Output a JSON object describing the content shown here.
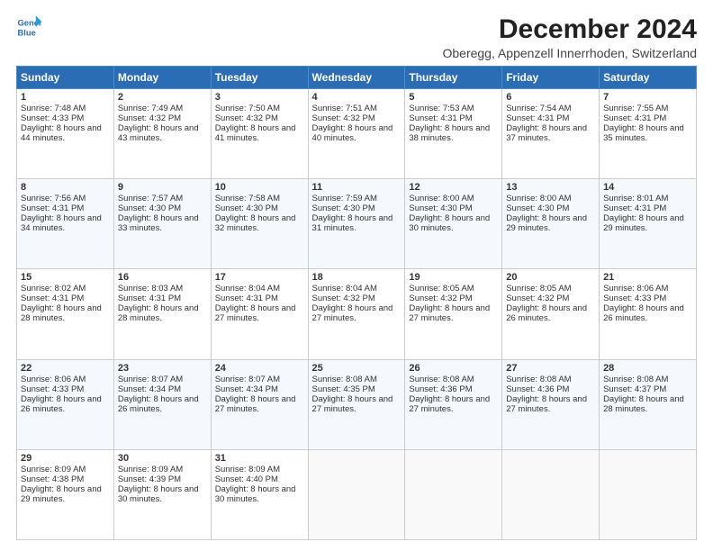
{
  "header": {
    "logo_line1": "General",
    "logo_line2": "Blue",
    "title": "December 2024",
    "subtitle": "Oberegg, Appenzell Innerrhoden, Switzerland"
  },
  "weekdays": [
    "Sunday",
    "Monday",
    "Tuesday",
    "Wednesday",
    "Thursday",
    "Friday",
    "Saturday"
  ],
  "weeks": [
    [
      {
        "day": "1",
        "rise": "Sunrise: 7:48 AM",
        "set": "Sunset: 4:33 PM",
        "daylight": "Daylight: 8 hours and 44 minutes."
      },
      {
        "day": "2",
        "rise": "Sunrise: 7:49 AM",
        "set": "Sunset: 4:32 PM",
        "daylight": "Daylight: 8 hours and 43 minutes."
      },
      {
        "day": "3",
        "rise": "Sunrise: 7:50 AM",
        "set": "Sunset: 4:32 PM",
        "daylight": "Daylight: 8 hours and 41 minutes."
      },
      {
        "day": "4",
        "rise": "Sunrise: 7:51 AM",
        "set": "Sunset: 4:32 PM",
        "daylight": "Daylight: 8 hours and 40 minutes."
      },
      {
        "day": "5",
        "rise": "Sunrise: 7:53 AM",
        "set": "Sunset: 4:31 PM",
        "daylight": "Daylight: 8 hours and 38 minutes."
      },
      {
        "day": "6",
        "rise": "Sunrise: 7:54 AM",
        "set": "Sunset: 4:31 PM",
        "daylight": "Daylight: 8 hours and 37 minutes."
      },
      {
        "day": "7",
        "rise": "Sunrise: 7:55 AM",
        "set": "Sunset: 4:31 PM",
        "daylight": "Daylight: 8 hours and 35 minutes."
      }
    ],
    [
      {
        "day": "8",
        "rise": "Sunrise: 7:56 AM",
        "set": "Sunset: 4:31 PM",
        "daylight": "Daylight: 8 hours and 34 minutes."
      },
      {
        "day": "9",
        "rise": "Sunrise: 7:57 AM",
        "set": "Sunset: 4:30 PM",
        "daylight": "Daylight: 8 hours and 33 minutes."
      },
      {
        "day": "10",
        "rise": "Sunrise: 7:58 AM",
        "set": "Sunset: 4:30 PM",
        "daylight": "Daylight: 8 hours and 32 minutes."
      },
      {
        "day": "11",
        "rise": "Sunrise: 7:59 AM",
        "set": "Sunset: 4:30 PM",
        "daylight": "Daylight: 8 hours and 31 minutes."
      },
      {
        "day": "12",
        "rise": "Sunrise: 8:00 AM",
        "set": "Sunset: 4:30 PM",
        "daylight": "Daylight: 8 hours and 30 minutes."
      },
      {
        "day": "13",
        "rise": "Sunrise: 8:00 AM",
        "set": "Sunset: 4:30 PM",
        "daylight": "Daylight: 8 hours and 29 minutes."
      },
      {
        "day": "14",
        "rise": "Sunrise: 8:01 AM",
        "set": "Sunset: 4:31 PM",
        "daylight": "Daylight: 8 hours and 29 minutes."
      }
    ],
    [
      {
        "day": "15",
        "rise": "Sunrise: 8:02 AM",
        "set": "Sunset: 4:31 PM",
        "daylight": "Daylight: 8 hours and 28 minutes."
      },
      {
        "day": "16",
        "rise": "Sunrise: 8:03 AM",
        "set": "Sunset: 4:31 PM",
        "daylight": "Daylight: 8 hours and 28 minutes."
      },
      {
        "day": "17",
        "rise": "Sunrise: 8:04 AM",
        "set": "Sunset: 4:31 PM",
        "daylight": "Daylight: 8 hours and 27 minutes."
      },
      {
        "day": "18",
        "rise": "Sunrise: 8:04 AM",
        "set": "Sunset: 4:32 PM",
        "daylight": "Daylight: 8 hours and 27 minutes."
      },
      {
        "day": "19",
        "rise": "Sunrise: 8:05 AM",
        "set": "Sunset: 4:32 PM",
        "daylight": "Daylight: 8 hours and 27 minutes."
      },
      {
        "day": "20",
        "rise": "Sunrise: 8:05 AM",
        "set": "Sunset: 4:32 PM",
        "daylight": "Daylight: 8 hours and 26 minutes."
      },
      {
        "day": "21",
        "rise": "Sunrise: 8:06 AM",
        "set": "Sunset: 4:33 PM",
        "daylight": "Daylight: 8 hours and 26 minutes."
      }
    ],
    [
      {
        "day": "22",
        "rise": "Sunrise: 8:06 AM",
        "set": "Sunset: 4:33 PM",
        "daylight": "Daylight: 8 hours and 26 minutes."
      },
      {
        "day": "23",
        "rise": "Sunrise: 8:07 AM",
        "set": "Sunset: 4:34 PM",
        "daylight": "Daylight: 8 hours and 26 minutes."
      },
      {
        "day": "24",
        "rise": "Sunrise: 8:07 AM",
        "set": "Sunset: 4:34 PM",
        "daylight": "Daylight: 8 hours and 27 minutes."
      },
      {
        "day": "25",
        "rise": "Sunrise: 8:08 AM",
        "set": "Sunset: 4:35 PM",
        "daylight": "Daylight: 8 hours and 27 minutes."
      },
      {
        "day": "26",
        "rise": "Sunrise: 8:08 AM",
        "set": "Sunset: 4:36 PM",
        "daylight": "Daylight: 8 hours and 27 minutes."
      },
      {
        "day": "27",
        "rise": "Sunrise: 8:08 AM",
        "set": "Sunset: 4:36 PM",
        "daylight": "Daylight: 8 hours and 27 minutes."
      },
      {
        "day": "28",
        "rise": "Sunrise: 8:08 AM",
        "set": "Sunset: 4:37 PM",
        "daylight": "Daylight: 8 hours and 28 minutes."
      }
    ],
    [
      {
        "day": "29",
        "rise": "Sunrise: 8:09 AM",
        "set": "Sunset: 4:38 PM",
        "daylight": "Daylight: 8 hours and 29 minutes."
      },
      {
        "day": "30",
        "rise": "Sunrise: 8:09 AM",
        "set": "Sunset: 4:39 PM",
        "daylight": "Daylight: 8 hours and 30 minutes."
      },
      {
        "day": "31",
        "rise": "Sunrise: 8:09 AM",
        "set": "Sunset: 4:40 PM",
        "daylight": "Daylight: 8 hours and 30 minutes."
      },
      null,
      null,
      null,
      null
    ]
  ]
}
